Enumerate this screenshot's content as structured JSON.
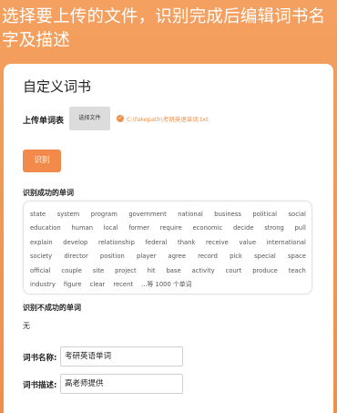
{
  "banner": {
    "text": "选择要上传的文件，识别完成后编辑词书名字及描述"
  },
  "card": {
    "title": "自定义词书",
    "upload_label": "上传单词表",
    "choose_file_button": "选择文件",
    "file_path": "C:\\fakepath\\考研英语单词.txt",
    "recognize_button": "识别",
    "success_label": "识别成功的单词",
    "success_words": [
      [
        "state",
        "system",
        "program",
        "government",
        "national",
        "business",
        "political",
        "social"
      ],
      [
        "education",
        "human",
        "local",
        "former",
        "require",
        "economic",
        "decide",
        "strong",
        "pull"
      ],
      [
        "explain",
        "develop",
        "relationship",
        "federal",
        "thank",
        "receive",
        "value",
        "international"
      ],
      [
        "society",
        "director",
        "position",
        "player",
        "agree",
        "record",
        "pick",
        "special",
        "space"
      ],
      [
        "official",
        "couple",
        "site",
        "project",
        "hit",
        "base",
        "activity",
        "court",
        "produce",
        "teach"
      ],
      [
        "industry",
        "figure",
        "clear",
        "recent",
        "...等 1000 个单词"
      ]
    ],
    "failed_label": "识别不成功的单词",
    "failed_value": "无",
    "book_name_label": "词书名称:",
    "book_name_value": "考研英语单词",
    "book_desc_label": "词书描述:",
    "book_desc_value": "高老师提供"
  }
}
